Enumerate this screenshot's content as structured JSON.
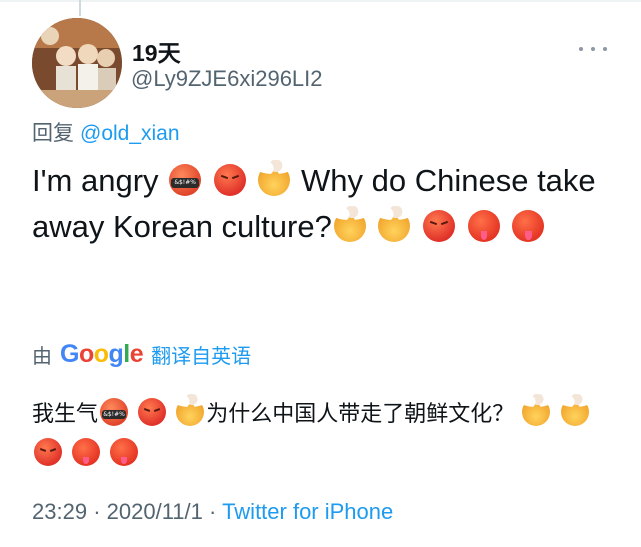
{
  "tweet": {
    "display_name": "19天",
    "handle": "@Ly9ZJE6xi296LI2",
    "reply_prefix": "回复",
    "reply_mention": "@old_xian",
    "text_part1": "I'm angry",
    "text_part2": "Why do Chinese take away Korean culture?",
    "translate_by": "由",
    "translate_brand_letters": [
      "G",
      "o",
      "o",
      "g",
      "l",
      "e"
    ],
    "translate_action": "翻译自英语",
    "translated_part1": "我生气",
    "translated_part2": "为什么中国人带走了朝鲜文化？",
    "time": "23:29",
    "separator": "·",
    "date": "2020/11/1",
    "source": "Twitter for iPhone"
  },
  "emoji": {
    "curse": "face-with-symbols-icon",
    "angry": "angry-face-icon",
    "explode": "exploding-head-icon",
    "hot": "hot-face-icon"
  },
  "colors": {
    "link": "#1d9bf0",
    "secondary_text": "#536471",
    "primary_text": "#0f1419"
  }
}
